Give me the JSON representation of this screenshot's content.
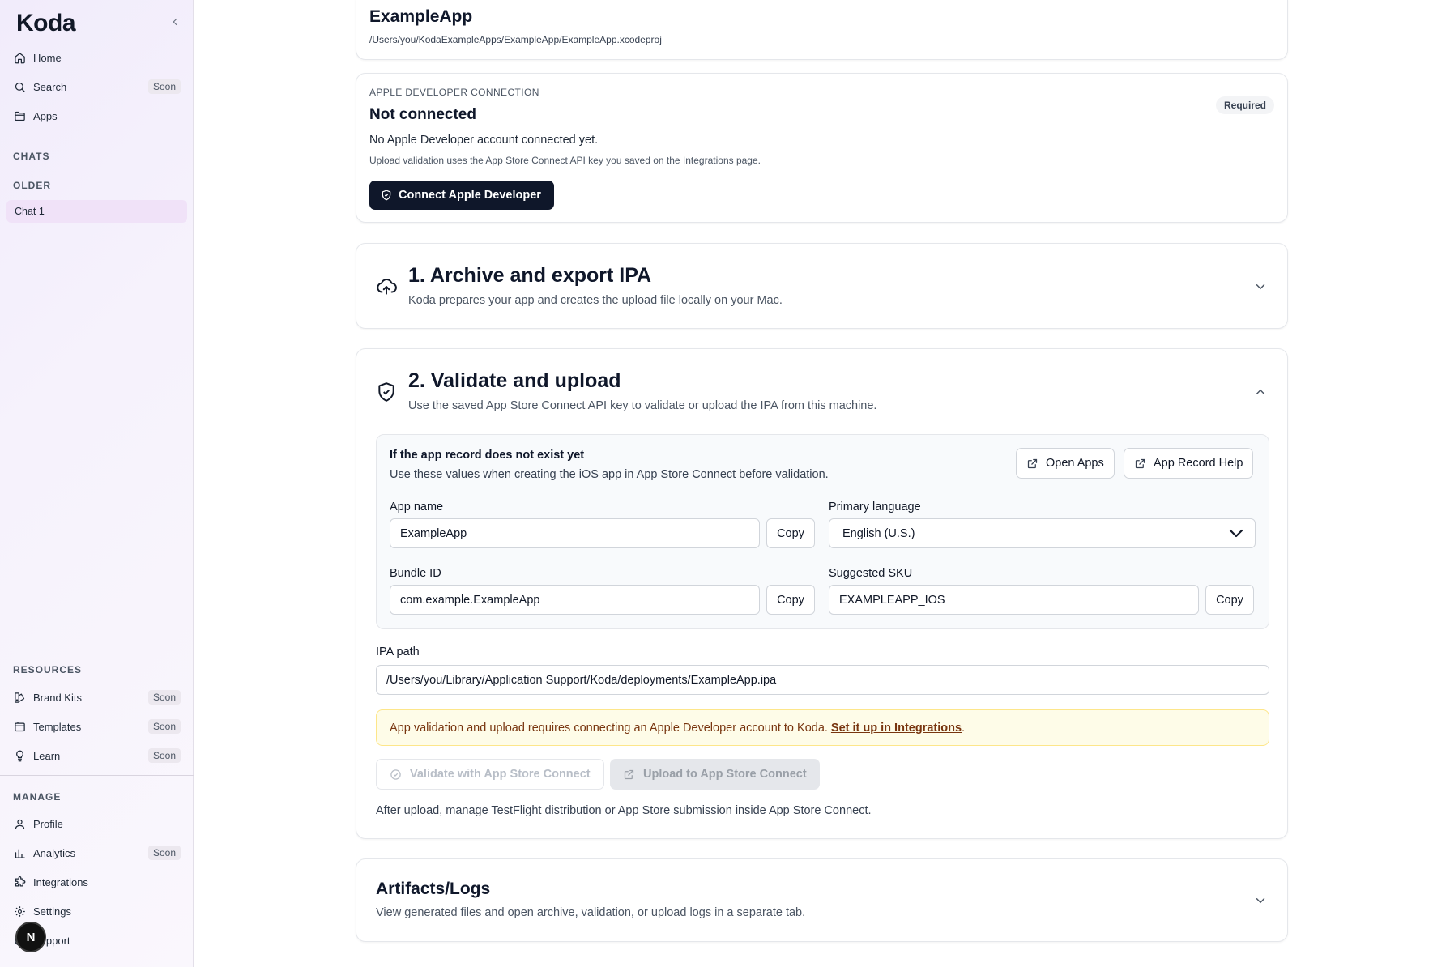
{
  "sidebar": {
    "brand": "Koda",
    "nav": [
      {
        "label": "Home",
        "icon": "home-icon"
      },
      {
        "label": "Search",
        "icon": "search-icon",
        "badge": "Soon"
      },
      {
        "label": "Apps",
        "icon": "folder-icon"
      }
    ],
    "chats_label": "CHATS",
    "older_label": "OLDER",
    "chats": [
      {
        "label": "Chat 1"
      }
    ],
    "resources_label": "RESOURCES",
    "resources": [
      {
        "label": "Brand Kits",
        "icon": "brand-kit-icon",
        "badge": "Soon"
      },
      {
        "label": "Templates",
        "icon": "templates-icon",
        "badge": "Soon"
      },
      {
        "label": "Learn",
        "icon": "lightbulb-icon",
        "badge": "Soon"
      }
    ],
    "manage_label": "MANAGE",
    "manage": [
      {
        "label": "Profile",
        "icon": "user-icon"
      },
      {
        "label": "Analytics",
        "icon": "chart-icon",
        "badge": "Soon"
      },
      {
        "label": "Integrations",
        "icon": "puzzle-icon"
      },
      {
        "label": "Settings",
        "icon": "gear-icon"
      },
      {
        "label": "Support",
        "icon": "help-icon"
      }
    ],
    "avatar_initial": "N"
  },
  "project": {
    "title": "ExampleApp",
    "path": "/Users/you/KodaExampleApps/ExampleApp/ExampleApp.xcodeproj"
  },
  "apple": {
    "eyebrow": "APPLE DEVELOPER CONNECTION",
    "title": "Not connected",
    "badge": "Required",
    "description": "No Apple Developer account connected yet.",
    "note": "Upload validation uses the App Store Connect API key you saved on the Integrations page.",
    "connect_label": "Connect Apple Developer"
  },
  "step1": {
    "title": "1. Archive and export IPA",
    "subtitle": "Koda prepares your app and creates the upload file locally on your Mac."
  },
  "step2": {
    "title": "2. Validate and upload",
    "subtitle": "Use the saved App Store Connect API key to validate or upload the IPA from this machine.",
    "record": {
      "title": "If the app record does not exist yet",
      "subtitle": "Use these values when creating the iOS app in App Store Connect before validation.",
      "open_apps_label": "Open Apps",
      "help_label": "App Record Help",
      "app_name_label": "App name",
      "app_name_value": "ExampleApp",
      "primary_language_label": "Primary language",
      "primary_language_value": "English (U.S.)",
      "bundle_id_label": "Bundle ID",
      "bundle_id_value": "com.example.ExampleApp",
      "sku_label": "Suggested SKU",
      "sku_value": "EXAMPLEAPP_IOS",
      "copy_label": "Copy"
    },
    "ipa_label": "IPA path",
    "ipa_value": "/Users/you/Library/Application Support/Koda/deployments/ExampleApp.ipa",
    "warning_text": "App validation and upload requires connecting an Apple Developer account to Koda.",
    "warning_link": "Set it up in Integrations",
    "warning_end": ".",
    "validate_label": "Validate with App Store Connect",
    "upload_label": "Upload to App Store Connect",
    "footer": "After upload, manage TestFlight distribution or App Store submission inside App Store Connect."
  },
  "artifacts": {
    "title": "Artifacts/Logs",
    "subtitle": "View generated files and open archive, validation, or upload logs in a separate tab."
  }
}
